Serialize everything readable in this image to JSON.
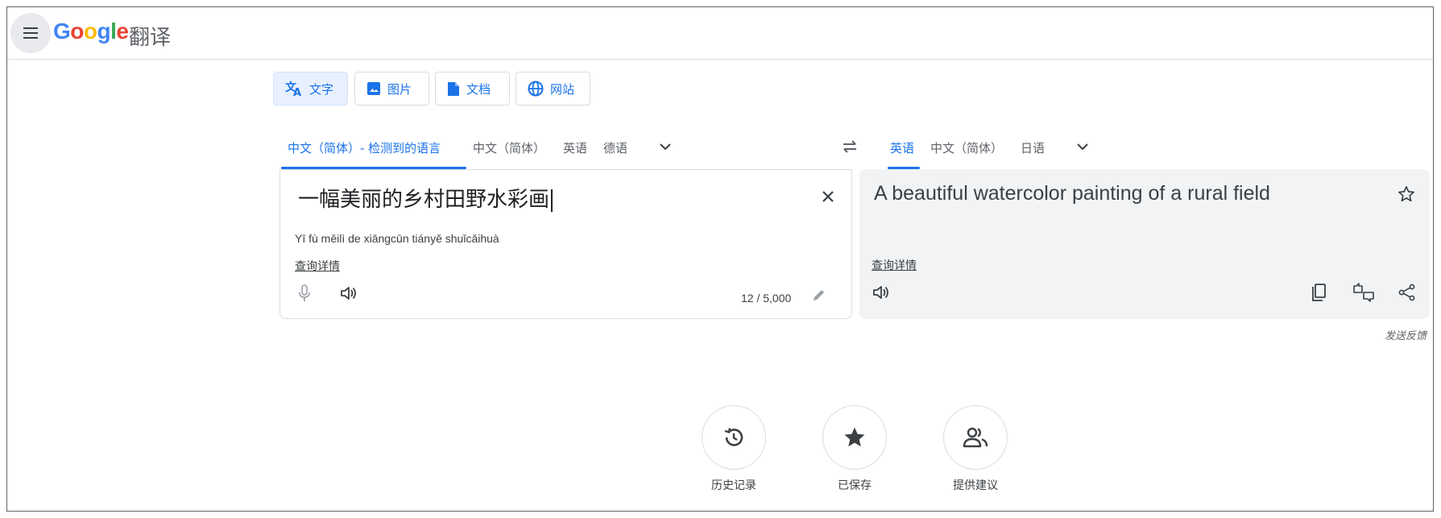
{
  "header": {
    "logo": [
      "G",
      "o",
      "o",
      "g",
      "l",
      "e"
    ],
    "logo_colors": [
      "#4285f4",
      "#ea4335",
      "#fbbc05",
      "#4285f4",
      "#34a853",
      "#ea4335"
    ],
    "app_name": "翻译"
  },
  "mode_tabs": [
    {
      "label": "文字",
      "icon": "translate-icon",
      "active": true
    },
    {
      "label": "图片",
      "icon": "image-icon"
    },
    {
      "label": "文档",
      "icon": "document-icon"
    },
    {
      "label": "网站",
      "icon": "globe-icon"
    }
  ],
  "source_langs": {
    "detected": "中文（简体）- 检测到的语言",
    "options": [
      "中文（简体）",
      "英语",
      "德语"
    ]
  },
  "target_langs": {
    "options": [
      "英语",
      "中文（简体）",
      "日语"
    ]
  },
  "source": {
    "text": "一幅美丽的乡村田野水彩画",
    "pinyin": "Yī fù měilì de xiāngcūn tiányě shuǐcǎihuà",
    "details_link": "查询详情",
    "char_count": "12 / 5,000"
  },
  "target": {
    "text": "A beautiful watercolor painting of a rural field",
    "details_link": "查询详情"
  },
  "feedback": "发送反馈",
  "bottom_actions": [
    {
      "label": "历史记录",
      "icon": "history-icon"
    },
    {
      "label": "已保存",
      "icon": "star-icon"
    },
    {
      "label": "提供建议",
      "icon": "people-icon"
    }
  ],
  "colors": {
    "accent": "#1a73e8",
    "text": "#202124",
    "muted": "#5f6368",
    "border": "#dadce0"
  }
}
